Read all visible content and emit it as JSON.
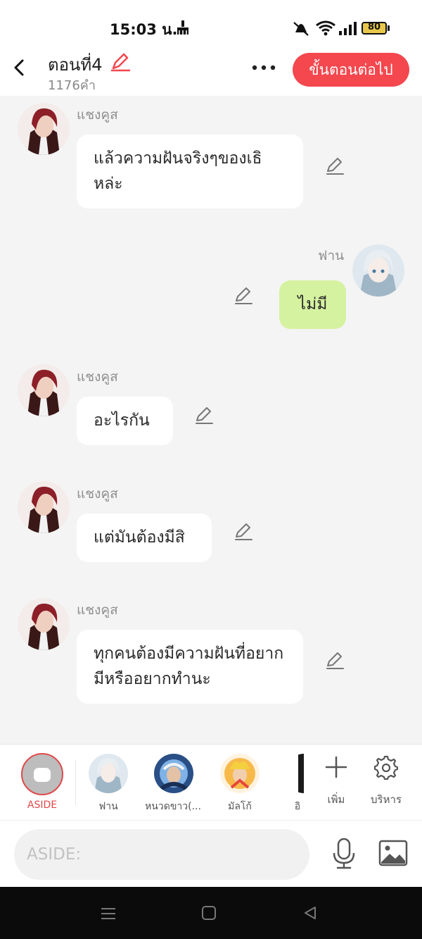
{
  "status_bar": {
    "time": "15:03 น.",
    "battery": "80",
    "icons": [
      "broom-icon",
      "mute-icon",
      "wifi-icon",
      "signal-icon",
      "battery-icon"
    ]
  },
  "header": {
    "title": "ตอนที่4",
    "word_count": "1176คำ",
    "next_button": "ขั้นตอนต่อไป",
    "accent_color": "#f4474e"
  },
  "messages": [
    {
      "speaker": "แชงคูส",
      "side": "left",
      "text": "แล้วความฝันจริงๆของเธิหล่ะ"
    },
    {
      "speaker": "ฟาน",
      "side": "right",
      "text": "ไม่มี"
    },
    {
      "speaker": "แชงคูส",
      "side": "left",
      "text": "อะไรกัน"
    },
    {
      "speaker": "แชงคูส",
      "side": "left",
      "text": "แต่มันต้องมีสิ"
    },
    {
      "speaker": "แชงคูส",
      "side": "left",
      "text": "ทุกคนต้องมีความฝันที่อยากมีหรืออยากทำนะ"
    }
  ],
  "character_bar": {
    "aside_label": "ASIDE",
    "characters": [
      {
        "name": "ฟาน"
      },
      {
        "name": "หนวดขาว(..."
      },
      {
        "name": "มัลโก้"
      },
      {
        "name": "อิ"
      }
    ],
    "add_label": "เพิ่ม",
    "manage_label": "บริหาร"
  },
  "input": {
    "placeholder": "ASIDE:"
  },
  "colors": {
    "bubble_right": "#d5f2a0",
    "aside_accent": "#e04a4a"
  }
}
